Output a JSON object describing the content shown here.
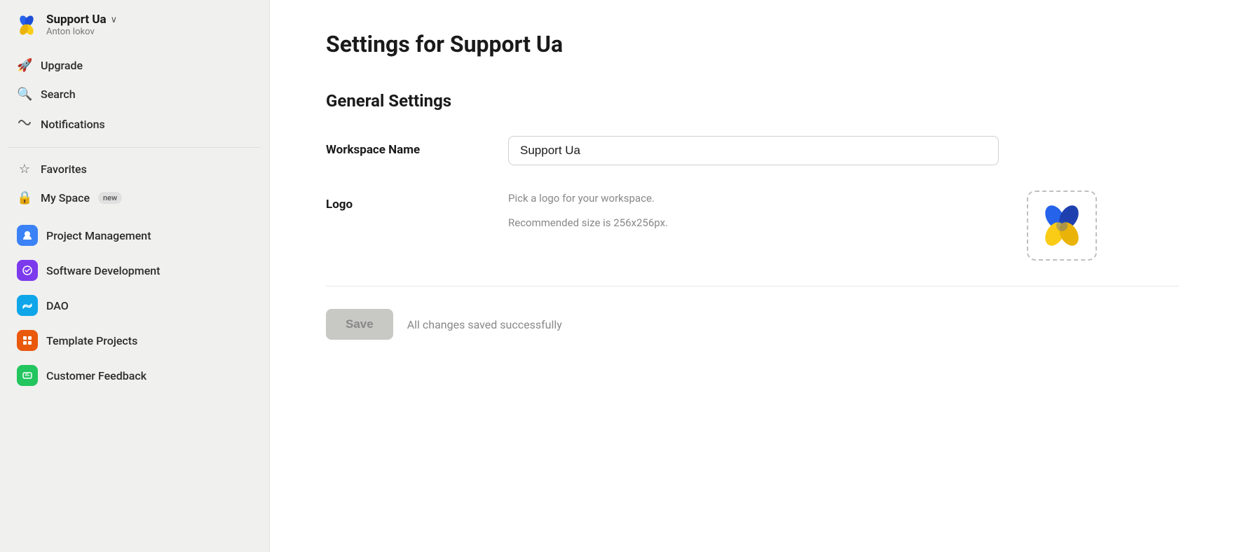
{
  "sidebar": {
    "workspace": {
      "name": "Support Ua",
      "user": "Anton Iokov",
      "chevron": "∨"
    },
    "nav_top": [
      {
        "id": "upgrade",
        "label": "Upgrade",
        "icon": "🚀"
      },
      {
        "id": "search",
        "label": "Search",
        "icon": "🔍"
      },
      {
        "id": "notifications",
        "label": "Notifications",
        "icon": "〰"
      }
    ],
    "nav_mid": [
      {
        "id": "favorites",
        "label": "Favorites",
        "icon": "☆",
        "badge": null
      },
      {
        "id": "my-space",
        "label": "My Space",
        "icon": "🔒",
        "badge": "new"
      }
    ],
    "nav_apps": [
      {
        "id": "project-management",
        "label": "Project Management",
        "color": "blue",
        "icon": "👤"
      },
      {
        "id": "software-development",
        "label": "Software Development",
        "color": "purple",
        "icon": "⚙"
      },
      {
        "id": "dao",
        "label": "DAO",
        "color": "teal",
        "icon": "📶"
      },
      {
        "id": "template-projects",
        "label": "Template Projects",
        "color": "orange",
        "icon": "◫"
      },
      {
        "id": "customer-feedback",
        "label": "Customer Feedback",
        "color": "green",
        "icon": "🎁"
      }
    ]
  },
  "main": {
    "page_title": "Settings for Support Ua",
    "section_title": "General Settings",
    "workspace_name_label": "Workspace Name",
    "workspace_name_value": "Support Ua",
    "logo_label": "Logo",
    "logo_desc_line1": "Pick a logo for your workspace.",
    "logo_desc_line2": "Recommended size is 256x256px.",
    "save_button_label": "Save",
    "save_success_message": "All changes saved successfully"
  }
}
